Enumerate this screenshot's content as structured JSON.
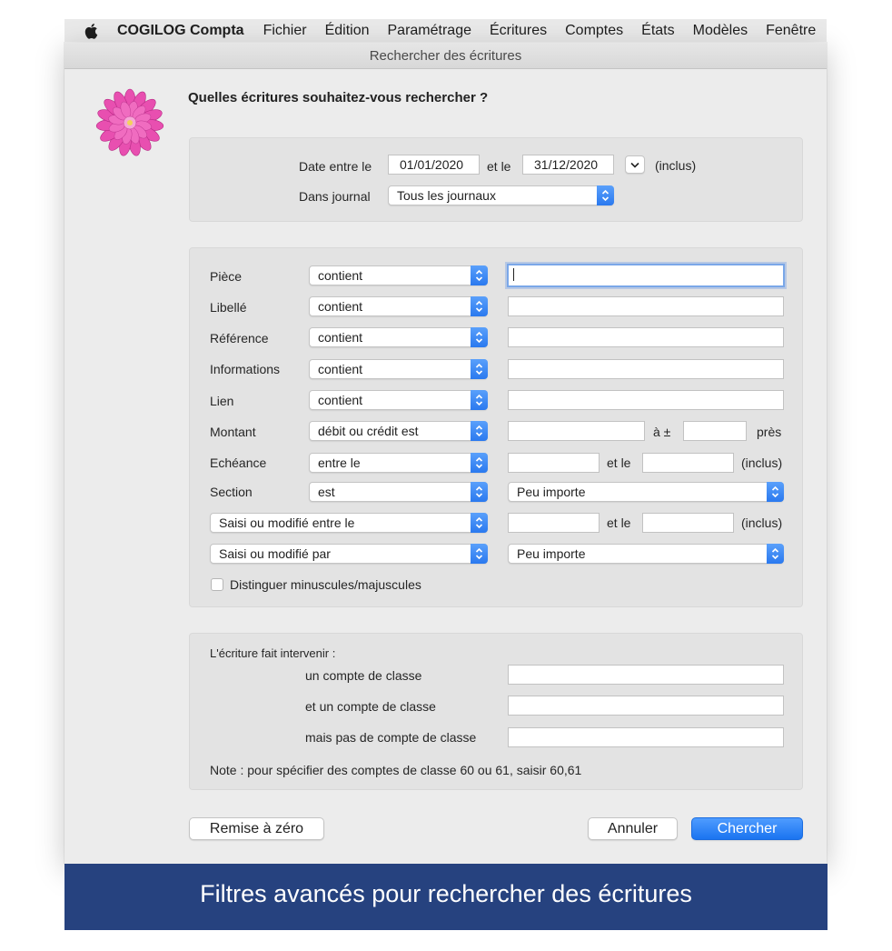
{
  "menubar": {
    "app_name": "COGILOG Compta",
    "items": [
      "Fichier",
      "Édition",
      "Paramétrage",
      "Écritures",
      "Comptes",
      "États",
      "Modèles",
      "Fenêtre"
    ]
  },
  "window": {
    "title": "Rechercher des écritures"
  },
  "question": "Quelles écritures souhaitez-vous rechercher ?",
  "date_panel": {
    "date_label": "Date entre le",
    "date_from": "01/01/2020",
    "and_label": "et le",
    "date_to": "31/12/2020",
    "inclusive": "(inclus)",
    "journal_label": "Dans journal",
    "journal_value": "Tous les journaux"
  },
  "criteria": {
    "piece": {
      "label": "Pièce",
      "op": "contient",
      "value": ""
    },
    "libelle": {
      "label": "Libellé",
      "op": "contient",
      "value": ""
    },
    "reference": {
      "label": "Référence",
      "op": "contient",
      "value": ""
    },
    "informations": {
      "label": "Informations",
      "op": "contient",
      "value": ""
    },
    "lien": {
      "label": "Lien",
      "op": "contient",
      "value": ""
    },
    "montant": {
      "label": "Montant",
      "op": "débit ou crédit est",
      "tolerance_label": "à ±",
      "pres_label": "près"
    },
    "echeance": {
      "label": "Echéance",
      "op": "entre le",
      "and_label": "et le",
      "inclusive": "(inclus)"
    },
    "section": {
      "label": "Section",
      "op": "est",
      "value": "Peu importe"
    },
    "saisi_entre": {
      "op": "Saisi ou modifié entre le",
      "and_label": "et le",
      "inclusive": "(inclus)"
    },
    "saisi_par": {
      "op": "Saisi ou modifié par",
      "value": "Peu importe"
    },
    "case_label": "Distinguer minuscules/majuscules"
  },
  "accounts_panel": {
    "heading": "L'écriture fait intervenir :",
    "row1": "un compte de classe",
    "row2": "et un compte de classe",
    "row3": "mais pas de compte de classe",
    "note": "Note : pour spécifier des comptes de classe 60 ou 61, saisir 60,61"
  },
  "buttons": {
    "reset": "Remise à zéro",
    "cancel": "Annuler",
    "search": "Chercher"
  },
  "banner": "Filtres avancés pour rechercher des écritures",
  "colors": {
    "accent": "#2a79ef",
    "banner": "#26427f",
    "window_bg": "#ececec",
    "panel_bg": "#e3e3e3"
  },
  "icons": {
    "apple": "apple-logo-icon",
    "app": "dahlia-flower-icon"
  }
}
